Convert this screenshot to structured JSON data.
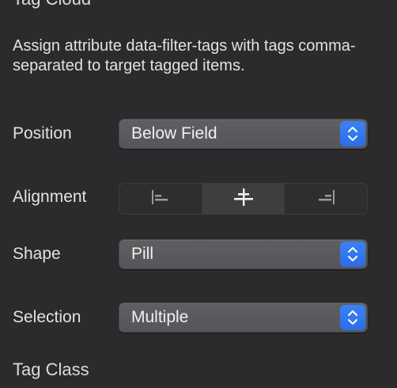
{
  "panel": {
    "section_title": "Tag Cloud",
    "description": "Assign attribute data-filter-tags with tags comma-separated to target tagged items.",
    "next_section_title": "Tag Class"
  },
  "position": {
    "label": "Position",
    "value": "Below Field"
  },
  "alignment": {
    "label": "Alignment",
    "options": [
      {
        "icon": "align-left-icon",
        "selected": false
      },
      {
        "icon": "align-center-icon",
        "selected": true
      },
      {
        "icon": "align-right-icon",
        "selected": false
      }
    ]
  },
  "shape": {
    "label": "Shape",
    "value": "Pill"
  },
  "selection": {
    "label": "Selection",
    "value": "Multiple"
  },
  "colors": {
    "background": "#2b2b2d",
    "accent": "#2a6ee6",
    "text": "#e2e2e2"
  }
}
